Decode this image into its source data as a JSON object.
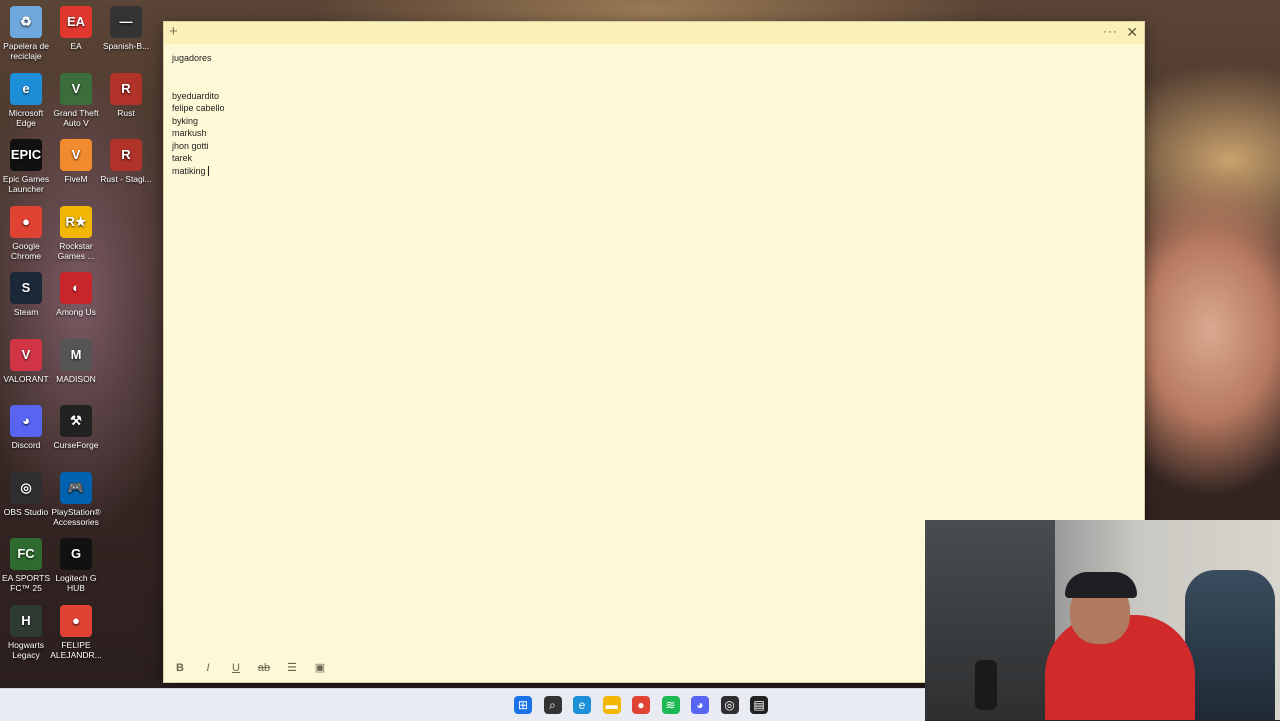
{
  "desktop": {
    "icons": [
      {
        "label": "Papelera de reciclaje",
        "glyph": "♻",
        "color": "#6fa8dc"
      },
      {
        "label": "EA",
        "glyph": "EA",
        "color": "#e0372f"
      },
      {
        "label": "Spanish-B...",
        "glyph": "—",
        "color": "#333333"
      },
      {
        "label": "Microsoft Edge",
        "glyph": "e",
        "color": "#1d8fd8"
      },
      {
        "label": "Grand Theft Auto V",
        "glyph": "V",
        "color": "#3c6e3c"
      },
      {
        "label": "Rust",
        "glyph": "R",
        "color": "#b03228"
      },
      {
        "label": "Epic Games Launcher",
        "glyph": "EPIC",
        "color": "#111111"
      },
      {
        "label": "FiveM",
        "glyph": "V",
        "color": "#f28b2e"
      },
      {
        "label": "Rust - Stagi...",
        "glyph": "R",
        "color": "#b03228"
      },
      {
        "label": "Google Chrome",
        "glyph": "●",
        "color": "#e04234"
      },
      {
        "label": "Rockstar Games ...",
        "glyph": "R★",
        "color": "#f2b705"
      },
      {
        "label": "Steam",
        "glyph": "S",
        "color": "#1b2838"
      },
      {
        "label": "Among Us",
        "glyph": "◐",
        "color": "#c9252d"
      },
      {
        "label": "VALORANT",
        "glyph": "V",
        "color": "#d13545"
      },
      {
        "label": "MADISON",
        "glyph": "M",
        "color": "#555555"
      },
      {
        "label": "Discord",
        "glyph": "◕",
        "color": "#5865f2"
      },
      {
        "label": "CurseForge",
        "glyph": "⚒",
        "color": "#222222"
      },
      {
        "label": "OBS Studio",
        "glyph": "◎",
        "color": "#302e31"
      },
      {
        "label": "PlayStation® Accessories",
        "glyph": "🎮",
        "color": "#0062b0"
      },
      {
        "label": "EA SPORTS FC™ 25",
        "glyph": "FC",
        "color": "#2f6b2f"
      },
      {
        "label": "Logitech G HUB",
        "glyph": "G",
        "color": "#111111"
      },
      {
        "label": "Hogwarts Legacy",
        "glyph": "H",
        "color": "#2e3b33"
      },
      {
        "label": "FELIPE ALEJANDR...",
        "glyph": "●",
        "color": "#e04234"
      }
    ]
  },
  "note": {
    "add_glyph": "+",
    "more_glyph": "···",
    "close_glyph": "✕",
    "lines": [
      "jugadores",
      "",
      "",
      "byeduardito",
      "felipe cabello",
      "byking",
      "markush",
      "jhon gotti",
      "tarek",
      "matiking"
    ],
    "toolbar": {
      "bold": "B",
      "italic": "I",
      "underline": "U",
      "strike": "ab",
      "list": "☰",
      "image": "▣"
    }
  },
  "taskbar": {
    "icons": [
      {
        "name": "start-icon",
        "glyph": "⊞",
        "color": "#1a73e8"
      },
      {
        "name": "search-icon",
        "glyph": "⌕",
        "color": "#333333"
      },
      {
        "name": "edge-icon",
        "glyph": "e",
        "color": "#1d8fd8"
      },
      {
        "name": "file-explorer-icon",
        "glyph": "▬",
        "color": "#f2b705"
      },
      {
        "name": "chrome-icon",
        "glyph": "●",
        "color": "#e04234"
      },
      {
        "name": "spotify-icon",
        "glyph": "≋",
        "color": "#1db954"
      },
      {
        "name": "messenger-icon",
        "glyph": "◕",
        "color": "#5865f2"
      },
      {
        "name": "obs-icon",
        "glyph": "◎",
        "color": "#302e31"
      },
      {
        "name": "sticky-notes-icon",
        "glyph": "▤",
        "color": "#222222"
      }
    ]
  }
}
